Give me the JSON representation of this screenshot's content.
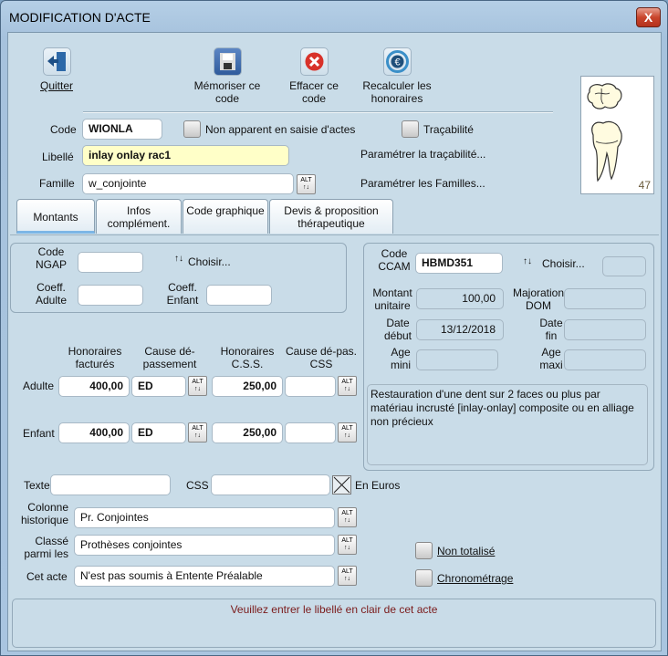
{
  "window": {
    "title": "MODIFICATION D'ACTE",
    "close_glyph": "X"
  },
  "toolbar": {
    "quit": "Quitter",
    "save": "Mémoriser ce code",
    "erase": "Effacer ce code",
    "recalc": "Recalculer les honoraires"
  },
  "tooth": {
    "number": "47"
  },
  "header": {
    "code_label": "Code",
    "code_value": "WIONLA",
    "non_apparent_label": "Non apparent en saisie d'actes",
    "tracabilite_label": "Traçabilité",
    "libelle_label": "Libellé",
    "libelle_value": "inlay onlay rac1",
    "param_trac": "Paramétrer la traçabilité...",
    "famille_label": "Famille",
    "famille_value": "w_conjointe",
    "param_fam": "Paramétrer les Familles..."
  },
  "tabs": [
    {
      "label": "Montants"
    },
    {
      "label": "Infos complément."
    },
    {
      "label": "Code graphique"
    },
    {
      "label": "Devis & proposition thérapeutique"
    }
  ],
  "alt_glyph": "ALT",
  "ngap": {
    "code_label": "Code NGAP",
    "choisir": "Choisir...",
    "coeff_adulte": "Coeff. Adulte",
    "coeff_enfant": "Coeff. Enfant"
  },
  "ccam": {
    "code_label": "Code CCAM",
    "code_value": "HBMD351",
    "choisir": "Choisir...",
    "montant_label": "Montant unitaire",
    "montant_value": "100,00",
    "majoration_label": "Majoration DOM",
    "date_debut_label": "Date début",
    "date_debut_value": "13/12/2018",
    "date_fin_label": "Date fin",
    "age_mini_label": "Age mini",
    "age_maxi_label": "Age maxi",
    "description": "Restauration d'une dent sur 2 faces ou plus par matériau incrusté [inlay-onlay] composite ou en alliage non précieux"
  },
  "fees": {
    "col_honoraires": "Honoraires facturés",
    "col_cause": "Cause dé-passement",
    "col_css": "Honoraires C.S.S.",
    "col_cause_css": "Cause dé-pas. CSS",
    "rows": [
      {
        "label": "Adulte",
        "honoraires": "400,00",
        "cause": "ED",
        "css": "250,00",
        "cause_css": ""
      },
      {
        "label": "Enfant",
        "honoraires": "400,00",
        "cause": "ED",
        "css": "250,00",
        "cause_css": ""
      }
    ]
  },
  "bottom": {
    "texte_label": "Texte",
    "css_label": "CSS",
    "en_euros_label": "En Euros",
    "colonne_label": "Colonne historique",
    "colonne_value": "Pr. Conjointes",
    "classe_label": "Classé parmi les",
    "classe_value": "Prothèses conjointes",
    "cet_acte_label": "Cet acte",
    "cet_acte_value": "N'est pas soumis à Entente Préalable",
    "non_totalise_label": "Non totalisé",
    "chrono_label": "Chronométrage"
  },
  "status": {
    "message": "Veuillez entrer le libellé en clair de cet acte"
  },
  "colors": {
    "status_text": "#7a1a1a",
    "libelle_bg": "#ffffc8",
    "close_red": "#c9452c"
  }
}
